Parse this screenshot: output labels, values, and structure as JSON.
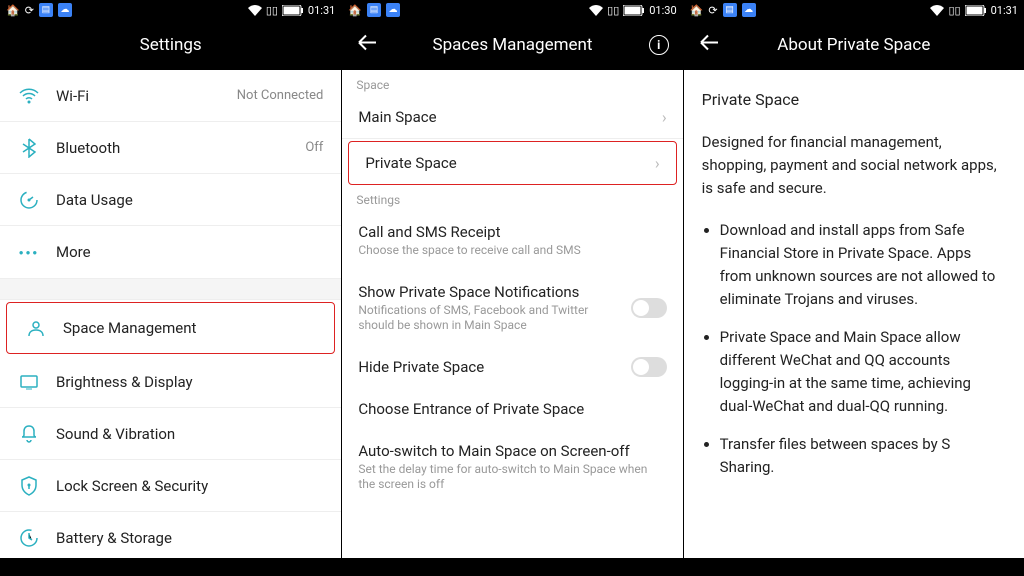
{
  "statusbar": {
    "times": [
      "01:31",
      "01:30",
      "01:31"
    ]
  },
  "panel1": {
    "title": "Settings",
    "rows": [
      {
        "icon": "wifi",
        "label": "Wi-Fi",
        "value": "Not Connected"
      },
      {
        "icon": "bt",
        "label": "Bluetooth",
        "value": "Off"
      },
      {
        "icon": "data",
        "label": "Data Usage",
        "value": ""
      },
      {
        "icon": "more",
        "label": "More",
        "value": ""
      }
    ],
    "rows2": [
      {
        "icon": "space",
        "label": "Space Management",
        "highlight": true
      },
      {
        "icon": "bright",
        "label": "Brightness & Display"
      },
      {
        "icon": "sound",
        "label": "Sound & Vibration"
      },
      {
        "icon": "lock",
        "label": "Lock Screen & Security"
      },
      {
        "icon": "batt",
        "label": "Battery & Storage"
      }
    ]
  },
  "panel2": {
    "title": "Spaces Management",
    "section1": "Space",
    "main_space": "Main Space",
    "private_space": "Private Space",
    "section2": "Settings",
    "items": [
      {
        "t": "Call and SMS Receipt",
        "s": "Choose the space to receive call and SMS"
      },
      {
        "t": "Show Private Space Notifications",
        "s": "Notifications of SMS, Facebook and Twitter should be shown in Main Space",
        "toggle": true
      },
      {
        "t": "Hide Private Space",
        "s": "",
        "toggle": true
      },
      {
        "t": "Choose Entrance of Private Space",
        "s": ""
      },
      {
        "t": "Auto-switch to Main Space on Screen-off",
        "s": "Set the delay time for auto-switch to Main Space when the screen is off"
      }
    ]
  },
  "panel3": {
    "title": "About Private Space",
    "heading": "Private Space",
    "para": "Designed for financial management, shopping, payment and social network apps, is safe and secure.",
    "bullets": [
      "Download and install apps from Safe Financial Store in Private Space. Apps from unknown sources are not allowed to eliminate Trojans and viruses.",
      "Private Space and Main Space allow different WeChat and QQ accounts logging-in at the same time, achieving dual-WeChat and dual-QQ running.",
      "Transfer files between spaces by S Sharing."
    ]
  }
}
